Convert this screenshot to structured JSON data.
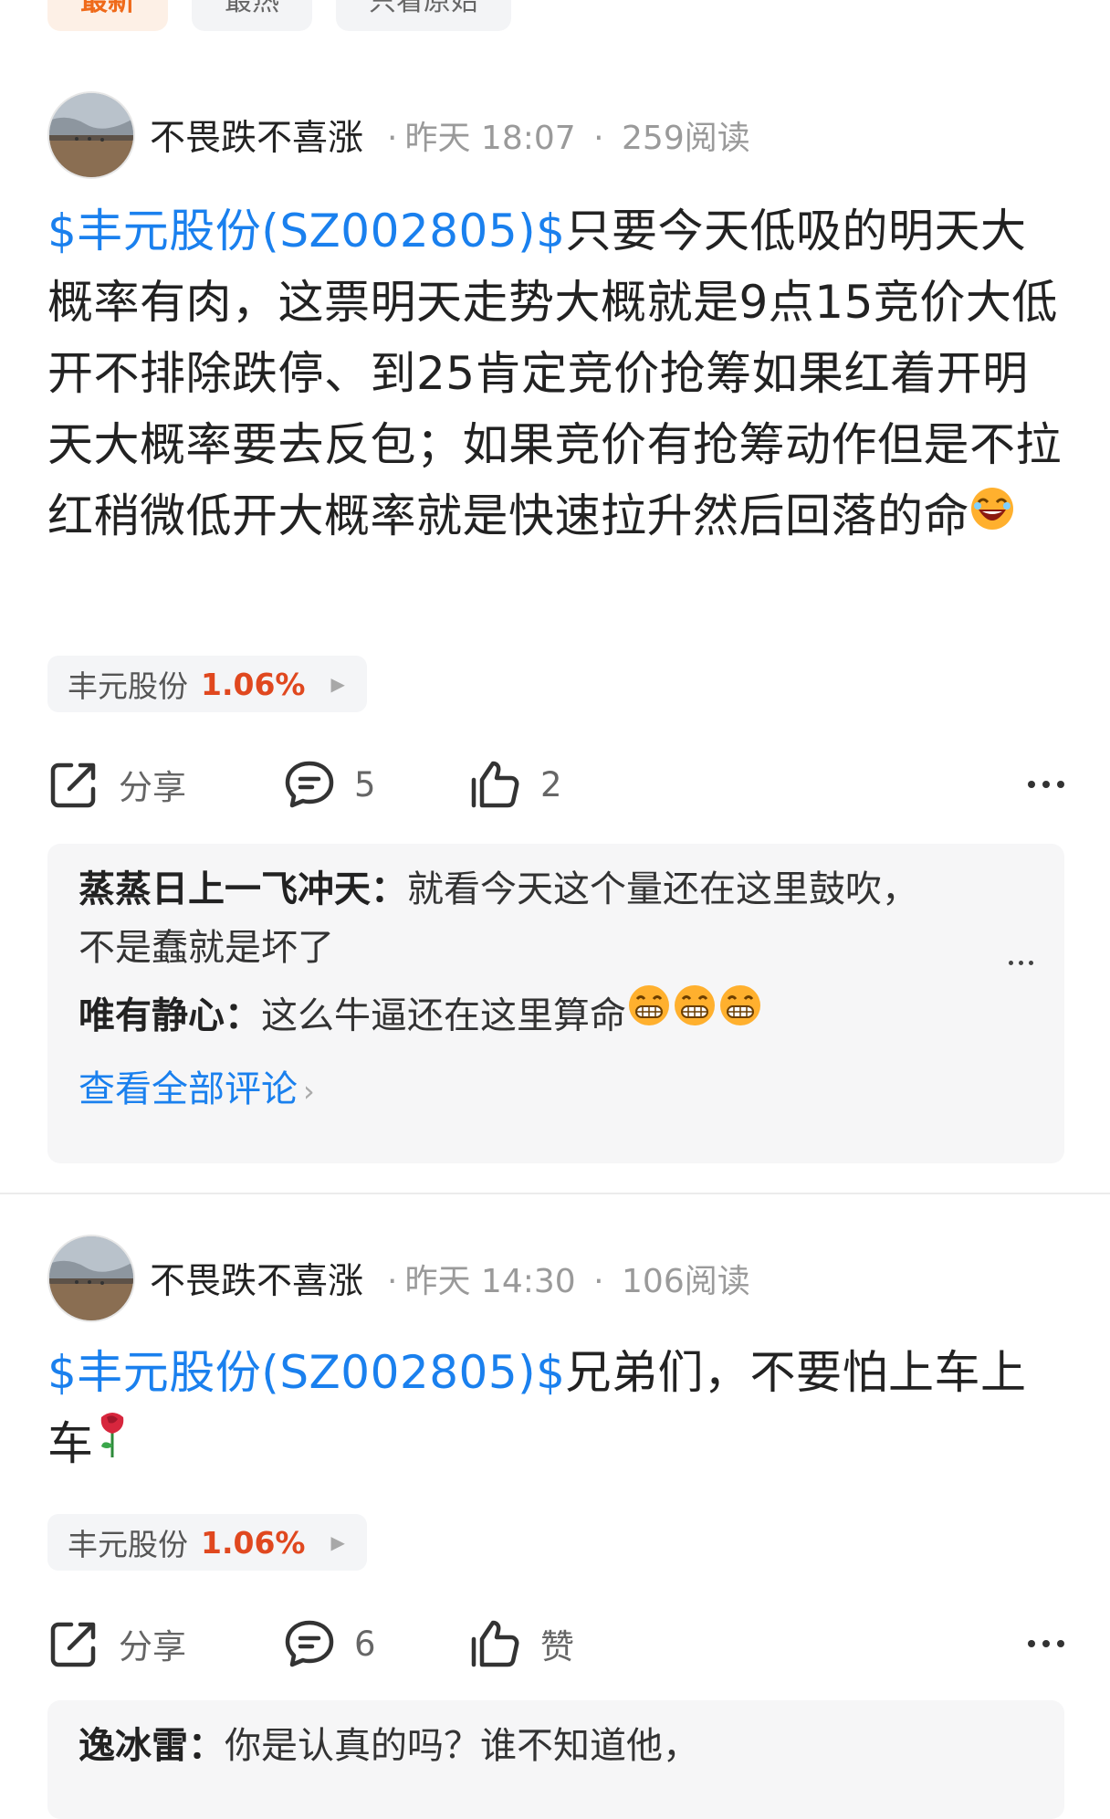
{
  "tabs": [
    {
      "label": "最新"
    },
    {
      "label": "最热"
    },
    {
      "label": "只看原始"
    }
  ],
  "posts": [
    {
      "author": "不畏跌不喜涨",
      "time": "昨天 18:07",
      "reads": "259阅读",
      "stock_link": "$丰元股份(SZ002805)$",
      "text": "只要今天低吸的明天大概率有肉，这票明天走势大概就是9点15竞价大低开不排除跌停、到25肯定竞价抢筹如果红着开明天大概率要去反包；如果竞价有抢筹动作但是不拉红稍微低开大概率就是快速拉升然后回落的命",
      "stock_tag": {
        "name": "丰元股份",
        "change": "1.06%"
      },
      "share_label": "分享",
      "comment_count": "5",
      "like_label": "2",
      "comments": [
        {
          "name": "蒸蒸日上一飞冲天：",
          "text": "就看今天这个量还在这里鼓吹，不是蠢就是坏了"
        },
        {
          "name": "唯有静心：",
          "text": "这么牛逼还在这里算命"
        }
      ],
      "view_all": "查看全部评论"
    },
    {
      "author": "不畏跌不喜涨",
      "time": "昨天 14:30",
      "reads": "106阅读",
      "stock_link": "$丰元股份(SZ002805)$",
      "text": "兄弟们，不要怕上车上车",
      "stock_tag": {
        "name": "丰元股份",
        "change": "1.06%"
      },
      "share_label": "分享",
      "comment_count": "6",
      "like_label": "赞",
      "comments": [
        {
          "name": "逸冰雷：",
          "text": "你是认真的吗？谁不知道他，"
        }
      ]
    }
  ],
  "colors": {
    "link": "#1a80ee",
    "up": "#e0481f",
    "accent": "#ef6a1a"
  },
  "icons": [
    "share-icon",
    "comment-icon",
    "like-icon",
    "more-icon",
    "laugh-emoji",
    "grin-emoji",
    "rose-emoji"
  ]
}
